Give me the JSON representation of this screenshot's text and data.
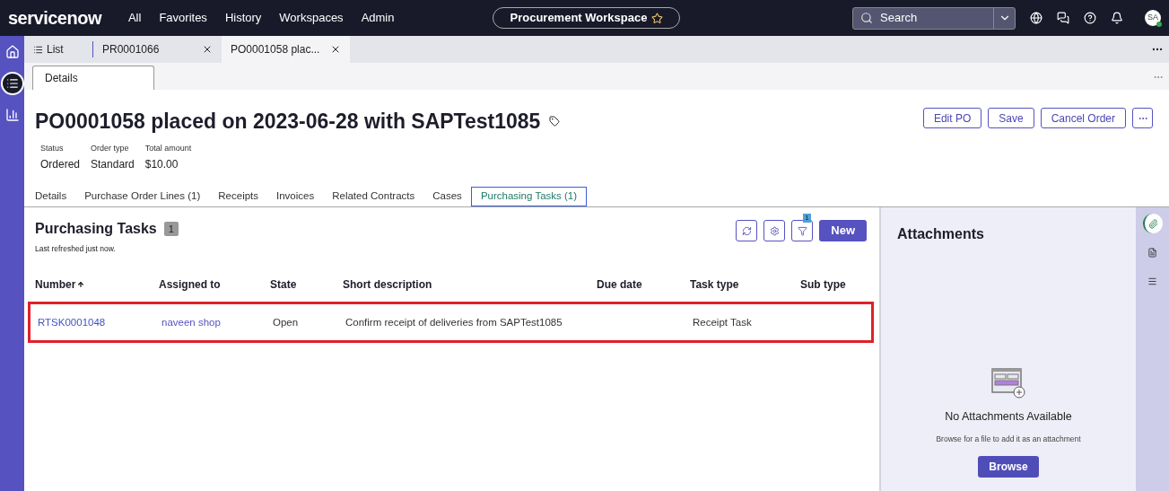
{
  "top_bar": {
    "logo": "servicenow",
    "menu": [
      "All",
      "Favorites",
      "History",
      "Workspaces",
      "Admin"
    ],
    "workspace": "Procurement Workspace",
    "search": {
      "placeholder": "Search"
    },
    "avatar": "SA"
  },
  "workspace_tabs": [
    {
      "label": "List",
      "selected": false,
      "closable": false
    },
    {
      "label": "PR0001066",
      "selected": false,
      "closable": true
    },
    {
      "label": "PO0001058 plac...",
      "selected": true,
      "closable": true
    }
  ],
  "sub_tabs": [
    {
      "label": "Details",
      "selected": true
    }
  ],
  "record": {
    "title": "PO0001058 placed on 2023-06-28 with SAPTest1085",
    "fields": [
      {
        "label": "Status",
        "value": "Ordered"
      },
      {
        "label": "Order type",
        "value": "Standard"
      },
      {
        "label": "Total amount",
        "value": "$10.00"
      }
    ],
    "actions": [
      "Edit PO",
      "Save",
      "Cancel Order"
    ]
  },
  "record_tabs": [
    {
      "label": "Details",
      "selected": false
    },
    {
      "label": "Purchase Order Lines (1)",
      "selected": false
    },
    {
      "label": "Receipts",
      "selected": false
    },
    {
      "label": "Invoices",
      "selected": false
    },
    {
      "label": "Related Contracts",
      "selected": false
    },
    {
      "label": "Cases",
      "selected": false
    },
    {
      "label": "Purchasing Tasks (1)",
      "selected": true
    }
  ],
  "list": {
    "title": "Purchasing Tasks",
    "count": "1",
    "refreshed": "Last refreshed just now.",
    "filter_count": "1",
    "new_button": "New",
    "columns": [
      "Number",
      "Assigned to",
      "State",
      "Short description",
      "Due date",
      "Task type",
      "Sub type"
    ],
    "rows": [
      {
        "highlighted": true,
        "cells": [
          "RTSK0001048",
          "naveen shop",
          "Open",
          "Confirm receipt of deliveries from SAPTest1085",
          "",
          "Receipt Task",
          ""
        ]
      }
    ]
  },
  "attachments": {
    "title": "Attachments",
    "empty_title": "No Attachments Available",
    "empty_text": "Browse for a file to add it as an attachment",
    "button": "Browse"
  },
  "side_rail": [
    {
      "selected": true
    },
    {
      "selected": false
    },
    {
      "selected": false
    }
  ]
}
